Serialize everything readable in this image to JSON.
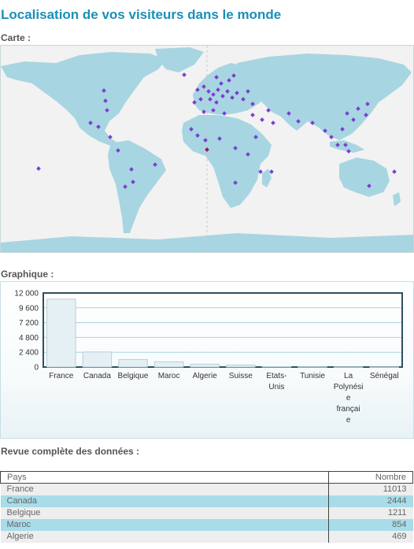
{
  "page": {
    "title": "Localisation de vos visiteurs dans le monde"
  },
  "sections": {
    "map_label": "Carte :",
    "chart_label": "Graphique :",
    "data_label": "Revue complète des données :"
  },
  "colors": {
    "title": "#1a8fb8",
    "land": "#a8d5e2",
    "ocean": "#f2f2f2",
    "visitor_marker": "#7a3fd1",
    "bar": "#e2eef3"
  },
  "chart_data": {
    "type": "bar",
    "title": "",
    "xlabel": "",
    "ylabel": "",
    "ylim": [
      0,
      12000
    ],
    "yticks": [
      0,
      2400,
      4800,
      7200,
      9600,
      12000
    ],
    "ytick_labels": [
      "0",
      "2 400",
      "4 800",
      "7 200",
      "9 600",
      "12 000"
    ],
    "categories": [
      "France",
      "Canada",
      "Belgique",
      "Maroc",
      "Algerie",
      "Suisse",
      "Etats-Unis",
      "Tunisie",
      "La Polynésie française",
      "Sénégal"
    ],
    "category_label_lines": [
      [
        "France"
      ],
      [
        "Canada"
      ],
      [
        "Belgique"
      ],
      [
        "Maroc"
      ],
      [
        "Algerie"
      ],
      [
        "Suisse"
      ],
      [
        "Etats-",
        "Unis"
      ],
      [
        "Tunisie"
      ],
      [
        "La",
        "Polynési",
        "e",
        "françai",
        "e"
      ],
      [
        "Sénégal"
      ]
    ],
    "values": [
      11013,
      2444,
      1211,
      854,
      469,
      320,
      60,
      40,
      20,
      15
    ],
    "grid": true
  },
  "table": {
    "headers": [
      "Pays",
      "Nombre"
    ],
    "rows": [
      [
        "France",
        "11013"
      ],
      [
        "Canada",
        "2444"
      ],
      [
        "Belgique",
        "1211"
      ],
      [
        "Maroc",
        "854"
      ],
      [
        "Algerie",
        "469"
      ]
    ]
  }
}
